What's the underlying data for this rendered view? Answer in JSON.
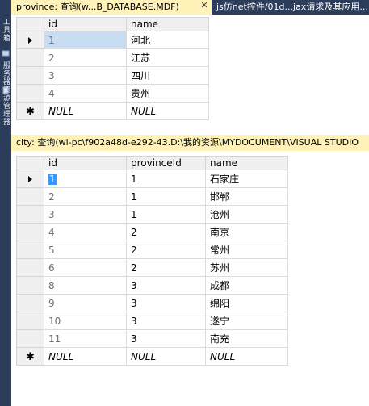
{
  "tabs": [
    {
      "label": "province: 查询(w...B_DATABASE.MDF)",
      "active": true,
      "close": "✕"
    },
    {
      "label": "js仿net控件/01d...jax请求及其应用...",
      "active": false
    }
  ],
  "side_labels": [
    "工具箱",
    "服务器资源管理器"
  ],
  "grid1": {
    "columns": [
      "id",
      "name"
    ],
    "rows": [
      {
        "id": "1",
        "name": "河北"
      },
      {
        "id": "2",
        "name": "江苏"
      },
      {
        "id": "3",
        "name": "四川"
      },
      {
        "id": "4",
        "name": "贵州"
      }
    ],
    "new_row": {
      "id": "NULL",
      "name": "NULL"
    }
  },
  "grid2": {
    "caption": "city: 查询(wl-pc\\f902a48d-e292-43.D:\\我的资源\\MYDOCUMENT\\VISUAL STUDIO",
    "columns": [
      "id",
      "provinceId",
      "name"
    ],
    "rows": [
      {
        "id": "1",
        "provinceId": "1",
        "name": "石家庄"
      },
      {
        "id": "2",
        "provinceId": "1",
        "name": "邯郸"
      },
      {
        "id": "3",
        "provinceId": "1",
        "name": "沧州"
      },
      {
        "id": "4",
        "provinceId": "2",
        "name": "南京"
      },
      {
        "id": "5",
        "provinceId": "2",
        "name": "常州"
      },
      {
        "id": "6",
        "provinceId": "2",
        "name": "苏州"
      },
      {
        "id": "8",
        "provinceId": "3",
        "name": "成都"
      },
      {
        "id": "9",
        "provinceId": "3",
        "name": "绵阳"
      },
      {
        "id": "10",
        "provinceId": "3",
        "name": "遂宁"
      },
      {
        "id": "11",
        "provinceId": "3",
        "name": "南充"
      }
    ],
    "new_row": {
      "id": "NULL",
      "provinceId": "NULL",
      "name": "NULL"
    }
  },
  "colors": {
    "tab_active_bg": "#fff2b8",
    "chrome_bg": "#2b3d5b",
    "selection": "#3399ff",
    "current_cell_bg": "#c8dcf2"
  },
  "icons": {
    "current_row": "arrow-right-icon",
    "new_row": "asterisk-icon"
  }
}
